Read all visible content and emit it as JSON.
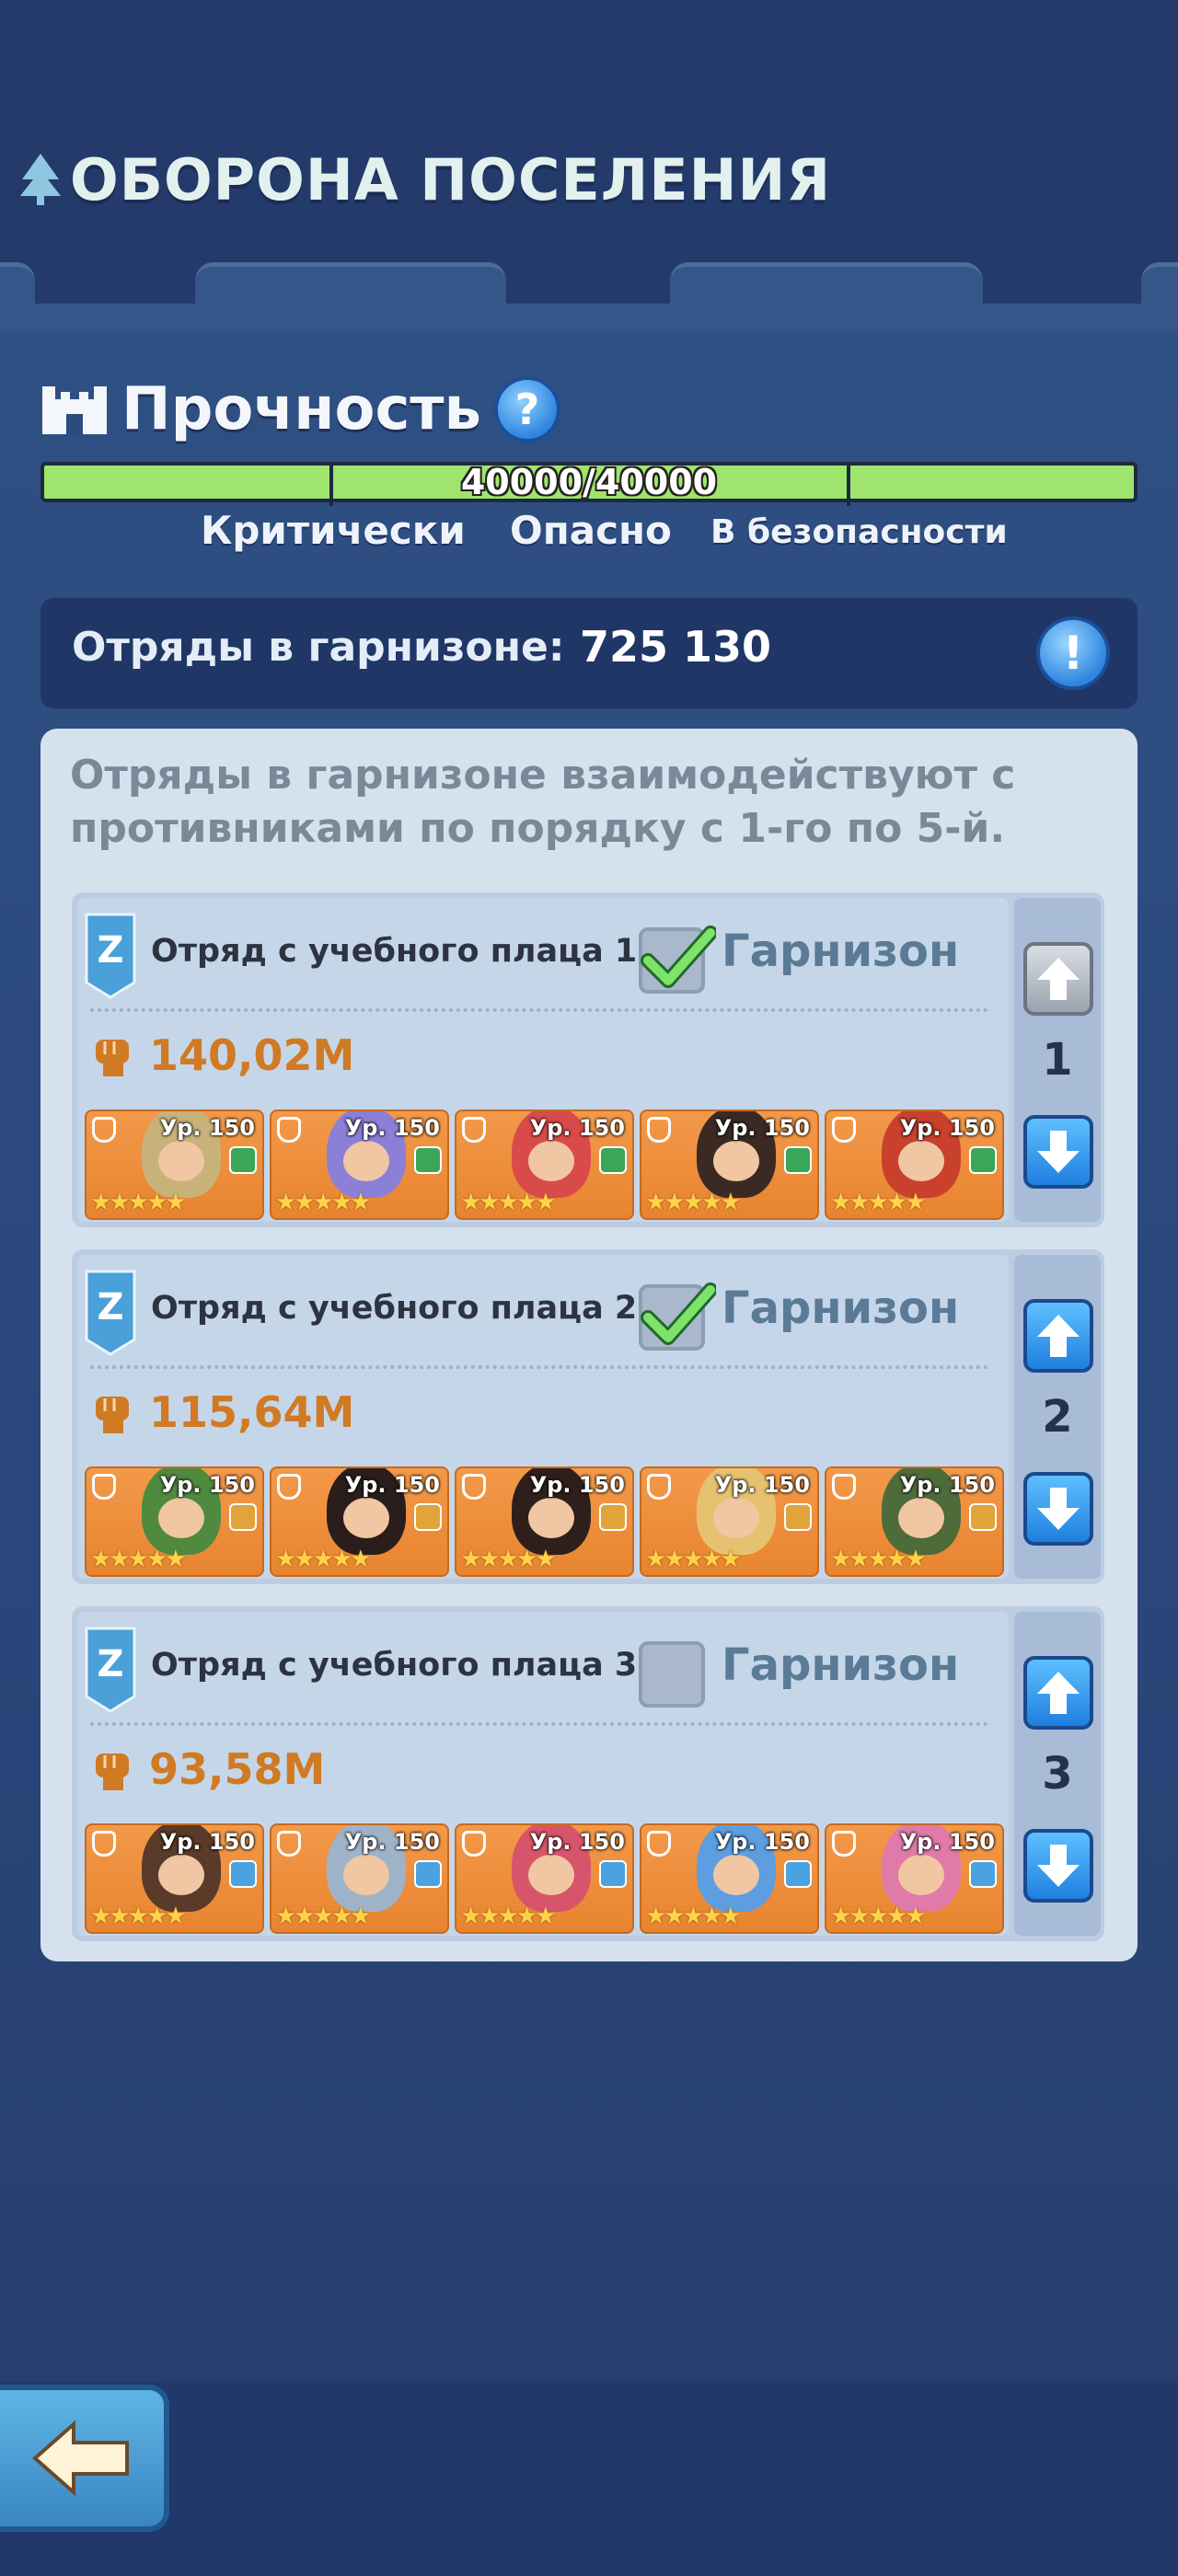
{
  "header": {
    "title": "ОБОРОНА ПОСЕЛЕНИЯ"
  },
  "durability": {
    "title": "Прочность",
    "value_text": "40000/40000",
    "current": 40000,
    "max": 40000,
    "levels": [
      "Критически",
      "Опасно",
      "В безопасности"
    ]
  },
  "garrison": {
    "label": "Отряды в гарнизоне:",
    "value": "725 130"
  },
  "panel": {
    "description": "Отряды в гарнизоне взаимодействуют с противниками по порядку с 1-го по 5-й.",
    "squads": [
      {
        "name": "Отряд с учебного плаца 1",
        "garrison_label": "Гарнизон",
        "checked": true,
        "power": "140,02M",
        "order": "1",
        "heroes": [
          {
            "level": "Ур. 150",
            "hair": "#c9b27a",
            "element": "#3aa657"
          },
          {
            "level": "Ур. 150",
            "hair": "#8b7fd6",
            "element": "#3aa657"
          },
          {
            "level": "Ур. 150",
            "hair": "#d94b4b",
            "element": "#3aa657"
          },
          {
            "level": "Ур. 150",
            "hair": "#3b2a24",
            "element": "#3aa657"
          },
          {
            "level": "Ур. 150",
            "hair": "#c9402d",
            "element": "#3aa657"
          }
        ]
      },
      {
        "name": "Отряд с учебного плаца 2",
        "garrison_label": "Гарнизон",
        "checked": true,
        "power": "115,64M",
        "order": "2",
        "heroes": [
          {
            "level": "Ур. 150",
            "hair": "#4f8a3e",
            "element": "#e0a43a"
          },
          {
            "level": "Ур. 150",
            "hair": "#2a1d1b",
            "element": "#e0a43a"
          },
          {
            "level": "Ур. 150",
            "hair": "#2e1f1a",
            "element": "#e0a43a"
          },
          {
            "level": "Ур. 150",
            "hair": "#e6c270",
            "element": "#e0a43a"
          },
          {
            "level": "Ур. 150",
            "hair": "#4e6b3a",
            "element": "#e0a43a"
          }
        ]
      },
      {
        "name": "Отряд с учебного плаца 3",
        "garrison_label": "Гарнизон",
        "checked": false,
        "power": "93,58M",
        "order": "3",
        "heroes": [
          {
            "level": "Ур. 150",
            "hair": "#5a3a28",
            "element": "#4aa3e0"
          },
          {
            "level": "Ур. 150",
            "hair": "#9fb3c8",
            "element": "#4aa3e0"
          },
          {
            "level": "Ур. 150",
            "hair": "#d8546a",
            "element": "#4aa3e0"
          },
          {
            "level": "Ур. 150",
            "hair": "#5c9ee0",
            "element": "#4aa3e0"
          },
          {
            "level": "Ур. 150",
            "hair": "#e07aa8",
            "element": "#4aa3e0"
          }
        ]
      }
    ]
  },
  "icons": {
    "title": "tree-icon",
    "durability": "castle-icon",
    "help": "help-icon",
    "info": "info-icon",
    "squad": "squad-badge-icon",
    "power": "fist-icon",
    "up": "arrow-up-icon",
    "down": "arrow-down-icon",
    "back": "back-arrow-icon"
  },
  "colors": {
    "hp_fill": "#9fe56d",
    "power": "#d07a24",
    "accent": "#2f86e0"
  }
}
